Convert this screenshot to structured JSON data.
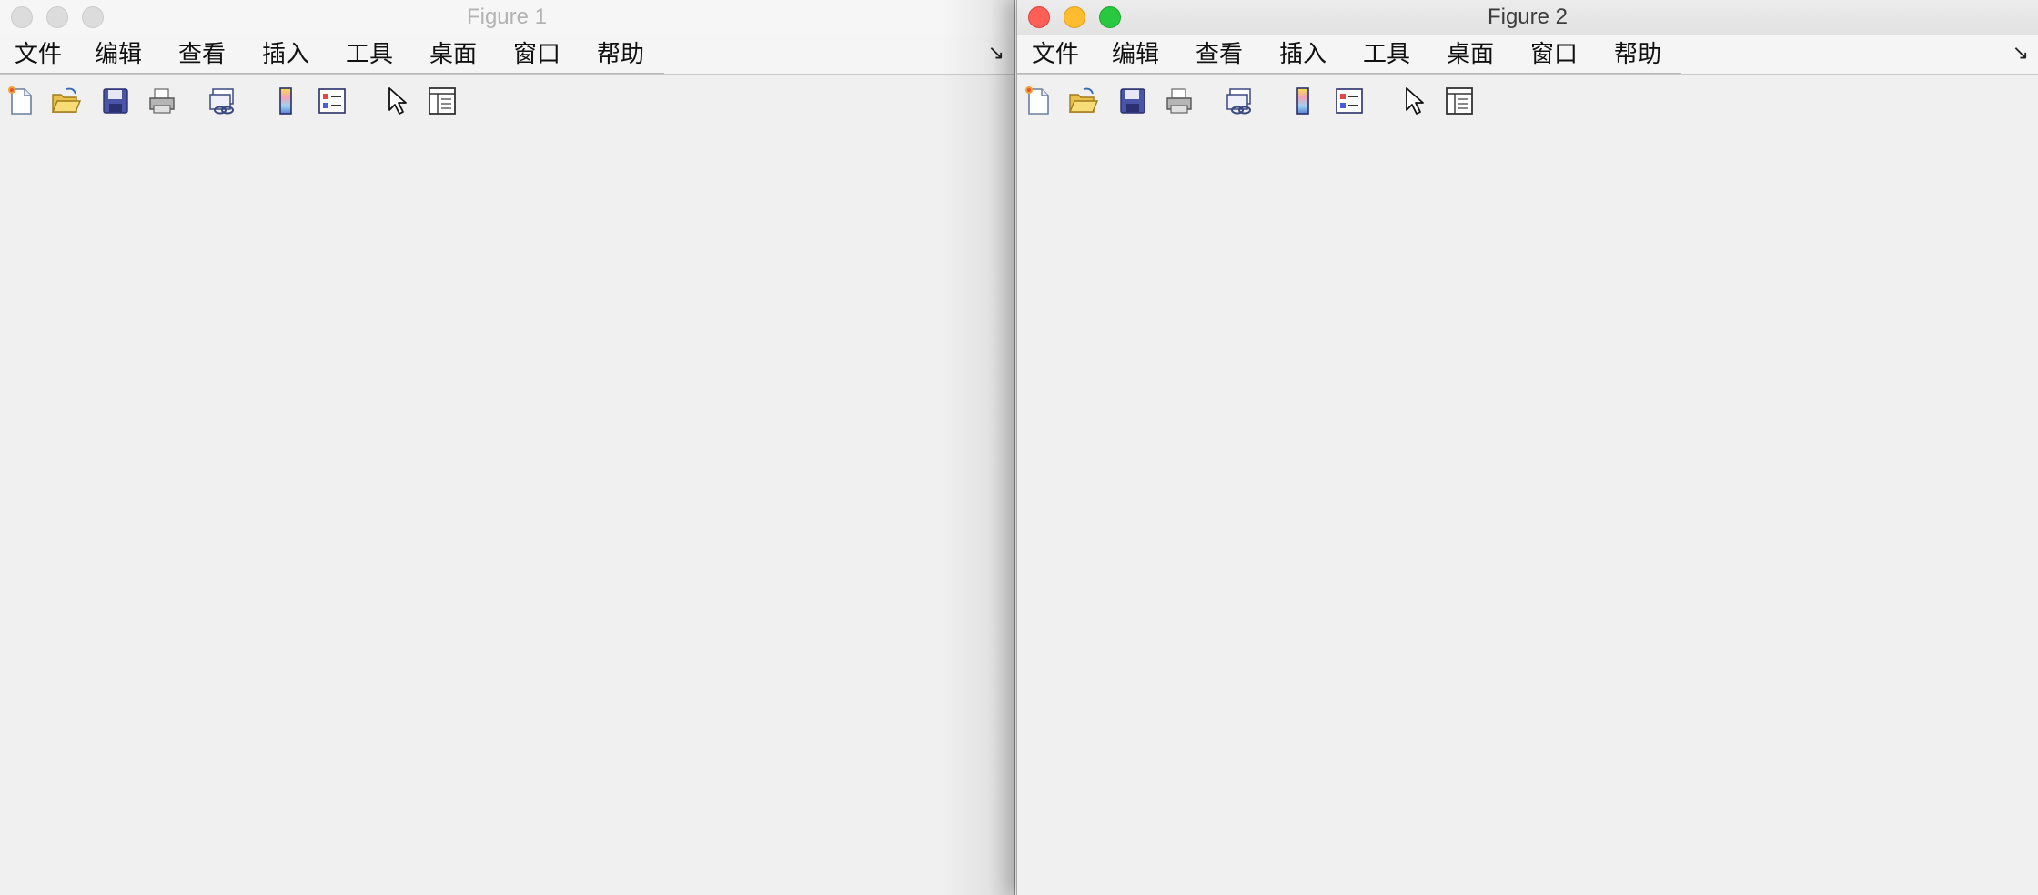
{
  "windows": [
    {
      "title": "Figure 1",
      "state": "inactive",
      "menu": [
        "文件",
        "编辑",
        "查看",
        "插入",
        "工具",
        "桌面",
        "窗口",
        "帮助"
      ],
      "toolbar_icons": [
        "new-figure-icon",
        "open-file-icon",
        "save-icon",
        "print-icon",
        "link-plot-icon",
        "colorbar-icon",
        "legend-icon",
        "pointer-icon",
        "property-inspector-icon"
      ],
      "dock_glyph": "↘"
    },
    {
      "title": "Figure 2",
      "state": "active",
      "menu": [
        "文件",
        "编辑",
        "查看",
        "插入",
        "工具",
        "桌面",
        "窗口",
        "帮助"
      ],
      "toolbar_icons": [
        "new-figure-icon",
        "open-file-icon",
        "save-icon",
        "print-icon",
        "link-plot-icon",
        "colorbar-icon",
        "legend-icon",
        "pointer-icon",
        "property-inspector-icon"
      ],
      "dock_glyph": "↘"
    }
  ],
  "colors": {
    "window_bg": "#f0f0f0",
    "close": "#fe5f57",
    "minimize": "#febc2e",
    "maximize": "#28c840",
    "inactive_light": "#dcdcdc"
  }
}
